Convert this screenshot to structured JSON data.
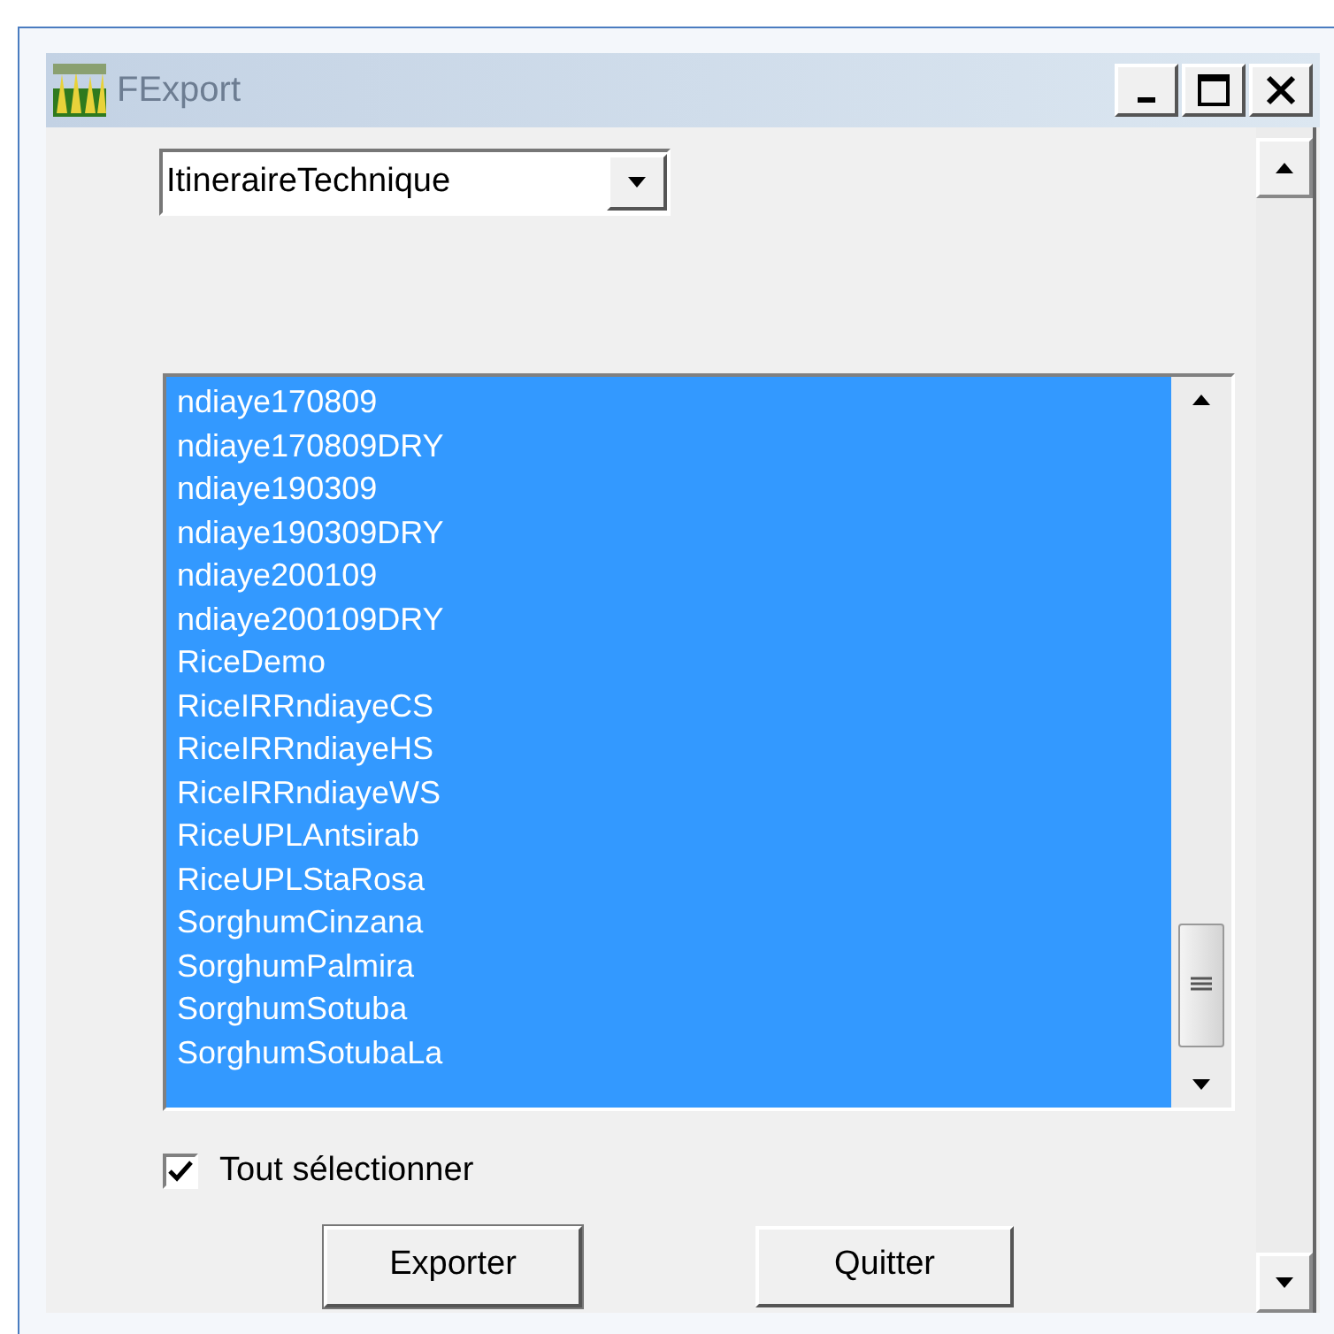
{
  "window": {
    "title": "FExport"
  },
  "dropdown": {
    "value": "ItineraireTechnique"
  },
  "list": {
    "items": [
      {
        "label": "ndiaye170809",
        "selected": true
      },
      {
        "label": "ndiaye170809DRY",
        "selected": true
      },
      {
        "label": "ndiaye190309",
        "selected": true
      },
      {
        "label": "ndiaye190309DRY",
        "selected": true
      },
      {
        "label": "ndiaye200109",
        "selected": true
      },
      {
        "label": "ndiaye200109DRY",
        "selected": true
      },
      {
        "label": "RiceDemo",
        "selected": true
      },
      {
        "label": "RiceIRRndiayeCS",
        "selected": true
      },
      {
        "label": "RiceIRRndiayeHS",
        "selected": true
      },
      {
        "label": "RiceIRRndiayeWS",
        "selected": true
      },
      {
        "label": "RiceUPLAntsirab",
        "selected": true
      },
      {
        "label": "RiceUPLStaRosa",
        "selected": true
      },
      {
        "label": "SorghumCinzana",
        "selected": true
      },
      {
        "label": "SorghumPalmira",
        "selected": true
      },
      {
        "label": "SorghumSotuba",
        "selected": true
      },
      {
        "label": "SorghumSotubaLa",
        "selected": true
      }
    ]
  },
  "select_all": {
    "label": "Tout sélectionner",
    "checked": true
  },
  "buttons": [
    "Exporter",
    "Quitter"
  ]
}
